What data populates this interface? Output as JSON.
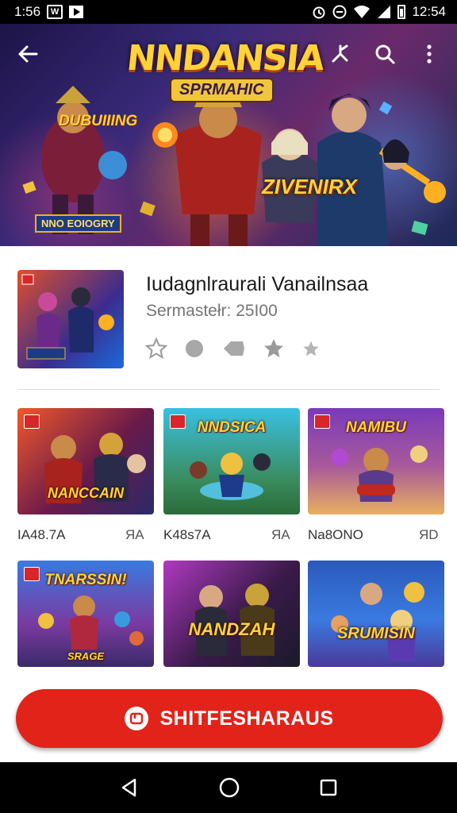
{
  "status_bar": {
    "time_left": "1:56",
    "time_right": "12:54",
    "icons_left": [
      "gallery-icon",
      "play-store-icon"
    ],
    "icons_right": [
      "alarm-icon",
      "dnd-icon",
      "wifi-icon",
      "signal-icon",
      "battery-icon"
    ],
    "box_glyph": "W"
  },
  "banner": {
    "title": "NNDANSIA",
    "subtitle": "SPRMAHIC",
    "left_text": "DUBUIIING",
    "badge": "NNO EOIOGRY",
    "right_text": "ZIVENIRX"
  },
  "toolbar": {
    "back_icon": "arrow-left-icon",
    "actions": [
      "share-icon",
      "search-icon",
      "more-vert-icon"
    ]
  },
  "app": {
    "name": "Iudagnlraurali Vanailnsaa",
    "subtitle": "Sermastełr: 25I00",
    "rating_icons": [
      "star-outline-icon",
      "circle-icon",
      "tag-icon",
      "star-icon",
      "star-small-icon"
    ]
  },
  "grid": {
    "cards": [
      {
        "caption": "NANCCAIN",
        "label": "IA48.7A",
        "right": "ЯA"
      },
      {
        "caption": "NNDSICA",
        "label": "K48s7A",
        "right": "ЯA"
      },
      {
        "caption": "NAMIBU",
        "label": "Na8ONO",
        "right": "ЯD"
      },
      {
        "caption": "TNARSSIN!",
        "bottom": "SRAGE",
        "label": "",
        "right": ""
      },
      {
        "caption": "NANDZAH",
        "label": "",
        "right": ""
      },
      {
        "caption": "SRUMISIN",
        "label": "",
        "right": ""
      }
    ]
  },
  "install": {
    "label": "SHITFESHARAUS",
    "icon": "app-logo-icon"
  },
  "nav": {
    "items": [
      "back-triangle-icon",
      "home-circle-icon",
      "recents-square-icon"
    ]
  },
  "colors": {
    "accent": "#e2231a",
    "title_gold": "#ffd23a",
    "status_bar": "#000000"
  }
}
